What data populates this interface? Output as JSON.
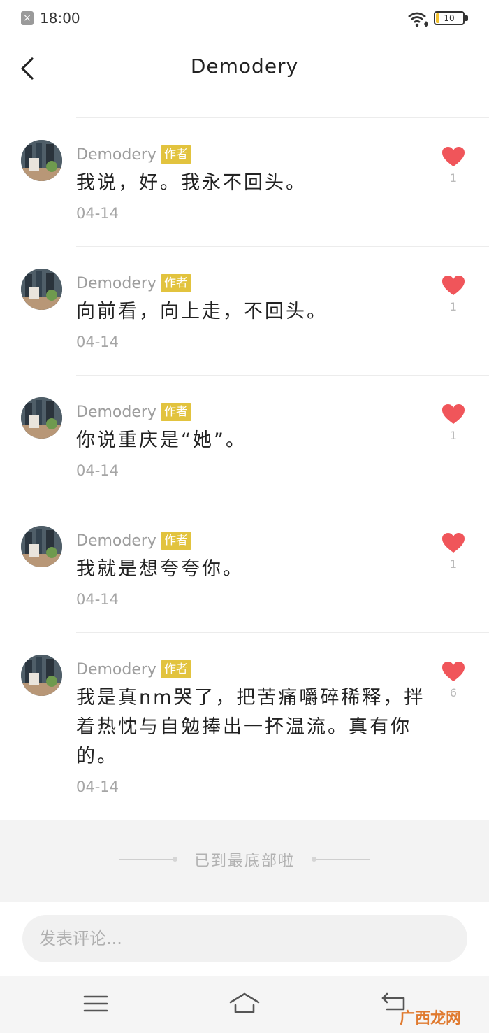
{
  "status_bar": {
    "time": "18:00",
    "battery_level": "10"
  },
  "header": {
    "title": "Demodery"
  },
  "comments": [
    {
      "author": "Demodery",
      "badge": "作者",
      "text": "我说，好。我永不回头。",
      "date": "04-14",
      "likes": "1"
    },
    {
      "author": "Demodery",
      "badge": "作者",
      "text": "向前看，向上走，不回头。",
      "date": "04-14",
      "likes": "1"
    },
    {
      "author": "Demodery",
      "badge": "作者",
      "text": "你说重庆是“她”。",
      "date": "04-14",
      "likes": "1"
    },
    {
      "author": "Demodery",
      "badge": "作者",
      "text": "我就是想夸夸你。",
      "date": "04-14",
      "likes": "1"
    },
    {
      "author": "Demodery",
      "badge": "作者",
      "text": "我是真nm哭了，把苦痛嚼碎稀释，拌着热忱与自勉捧出一抔温流。真有你的。",
      "date": "04-14",
      "likes": "6"
    }
  ],
  "end_text": "已到最底部啦",
  "input": {
    "placeholder": "发表评论..."
  },
  "watermark": "广西龙网",
  "colors": {
    "badge": "#e2c33e",
    "heart": "#f0555a",
    "background_end": "#f3f3f3"
  },
  "icons": {
    "back": "chevron-left-icon",
    "like": "heart-icon",
    "menu": "menu-icon",
    "home": "home-icon",
    "back_nav": "return-icon"
  }
}
